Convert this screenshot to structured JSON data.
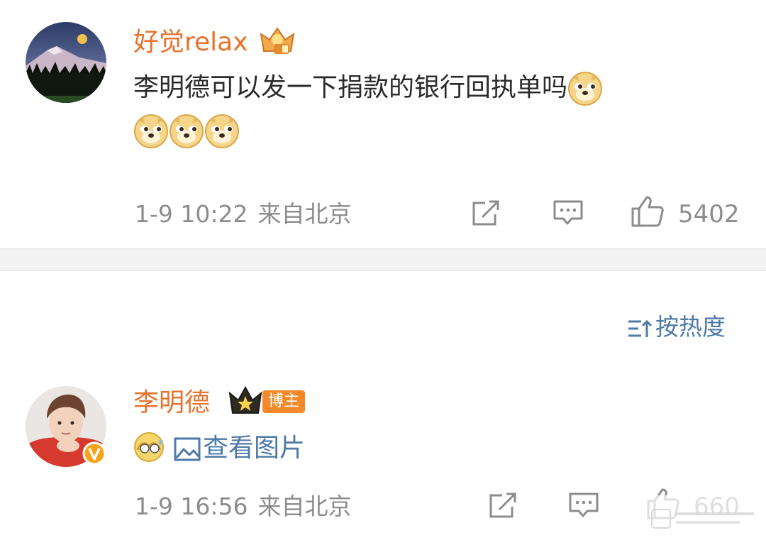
{
  "comments": [
    {
      "username": "好觉relax",
      "text": "李明德可以发一下捐款的银行回执单吗",
      "emoji_icon": "doge-emoji-icon",
      "time": "1-9 10:22",
      "from": "来自北京",
      "likes": "5402"
    },
    {
      "username": "李明德",
      "badge_label": "博主",
      "view_image_label": "查看图片",
      "time": "1-9 16:56",
      "from": "来自北京",
      "likes": "660"
    }
  ],
  "sort": {
    "label": "按热度"
  },
  "colors": {
    "username": "#e8722c",
    "link": "#4e7aa8",
    "meta": "#8c8c8c",
    "divider": "#f2f2f2"
  }
}
